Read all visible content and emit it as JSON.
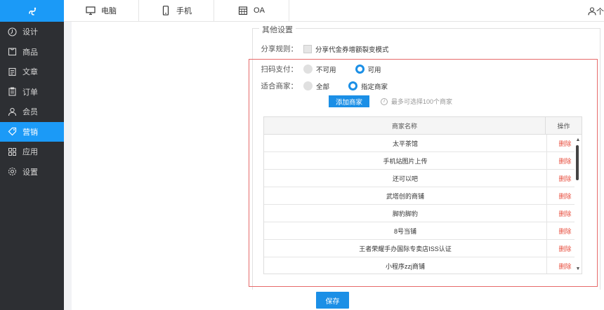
{
  "sidebar": {
    "items": [
      {
        "label": "设计",
        "icon": "design-icon",
        "active": false
      },
      {
        "label": "商品",
        "icon": "goods-icon",
        "active": false
      },
      {
        "label": "文章",
        "icon": "article-icon",
        "active": false
      },
      {
        "label": "订单",
        "icon": "order-icon",
        "active": false
      },
      {
        "label": "会员",
        "icon": "member-icon",
        "active": false
      },
      {
        "label": "营销",
        "icon": "tag-icon",
        "active": true
      },
      {
        "label": "应用",
        "icon": "apps-icon",
        "active": false
      },
      {
        "label": "设置",
        "icon": "gear-icon",
        "active": false
      }
    ]
  },
  "topbar": {
    "tabs": [
      {
        "label": "电脑",
        "icon": "monitor-icon"
      },
      {
        "label": "手机",
        "icon": "phone-icon"
      },
      {
        "label": "OA",
        "icon": "calendar-grid-icon"
      }
    ],
    "user_text": "个"
  },
  "section": {
    "legend": "其他设置",
    "share": {
      "label": "分享规则：",
      "option": "分享代金券增额裂变模式"
    },
    "scan_pay": {
      "label": "扫码支付：",
      "options": [
        "不可用",
        "可用"
      ],
      "selected": "可用"
    },
    "merchants": {
      "label": "适合商家：",
      "options": [
        "全部",
        "指定商家"
      ],
      "selected": "指定商家"
    },
    "add_button": "添加商家",
    "hint": "最多可选择100个商家",
    "hint_icon": "i"
  },
  "table": {
    "headers": [
      "商家名称",
      "操作"
    ],
    "rows": [
      {
        "name": "太平茶馆",
        "action": "删除"
      },
      {
        "name": "手机站图片上传",
        "action": "删除"
      },
      {
        "name": "还可以吧",
        "action": "删除"
      },
      {
        "name": "武塔创的商铺",
        "action": "删除"
      },
      {
        "name": "脚豹脚豹",
        "action": "删除"
      },
      {
        "name": "8号当铺",
        "action": "删除"
      },
      {
        "name": "王者荣耀手办国际专卖店ISS认证",
        "action": "删除"
      },
      {
        "name": "小程序zzj商铺",
        "action": "删除"
      }
    ]
  },
  "save_button": "保存",
  "colors": {
    "accent": "#1b8fe6",
    "sidebar_bg": "#2d2f33",
    "delete": "#e74c3c",
    "highlight_border": "#e66a6a"
  }
}
